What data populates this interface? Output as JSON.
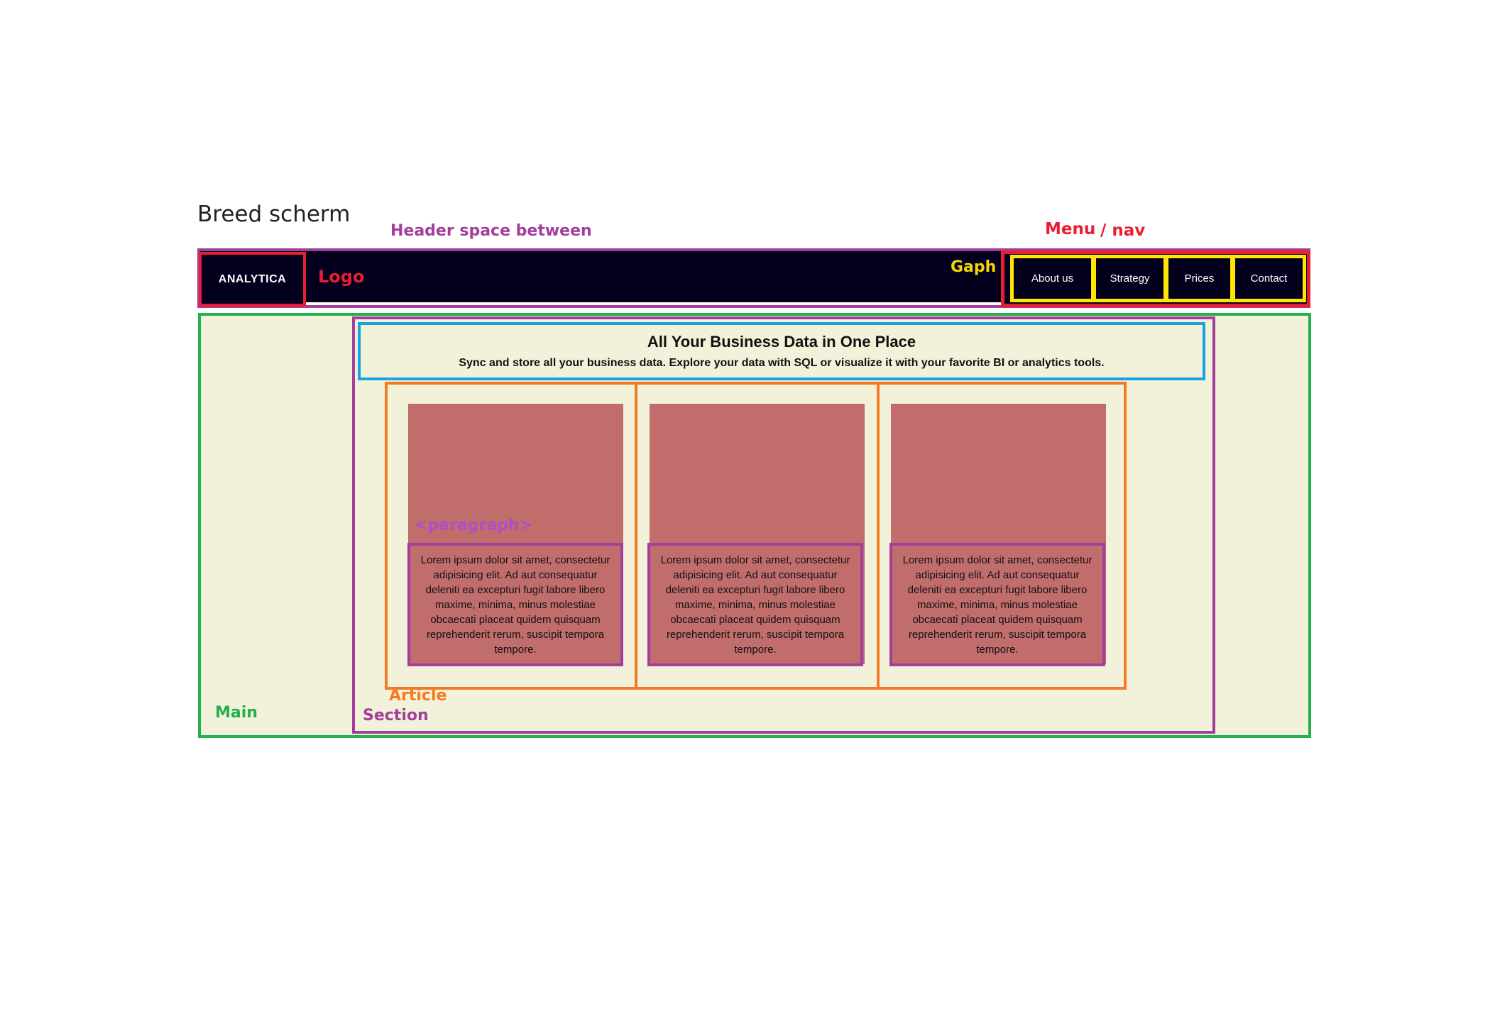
{
  "title": "Breed scherm",
  "annotations": {
    "header": "Header space between",
    "menu": "Menu",
    "nav": "/ nav",
    "logo": "Logo",
    "gaph": "Gaph",
    "paragraph": "<paragraph>",
    "article": "Article",
    "main": "Main",
    "section": "Section"
  },
  "logo": "ANALYTICA",
  "nav": [
    "About us",
    "Strategy",
    "Prices",
    "Contact"
  ],
  "heading": {
    "title": "All Your Business Data in One Place",
    "subtitle": "Sync and store all your business data. Explore your data with SQL or visualize it with your favorite BI or analytics tools."
  },
  "articles": [
    {
      "paragraph": "Lorem ipsum dolor sit amet, consectetur adipisicing elit. Ad aut consequatur deleniti ea excepturi fugit labore libero maxime, minima, minus molestiae obcaecati placeat quidem quisquam reprehenderit rerum, suscipit tempora tempore."
    },
    {
      "paragraph": "Lorem ipsum dolor sit amet, consectetur adipisicing elit. Ad aut consequatur deleniti ea excepturi fugit labore libero maxime, minima, minus molestiae obcaecati placeat quidem quisquam reprehenderit rerum, suscipit tempora tempore."
    },
    {
      "paragraph": "Lorem ipsum dolor sit amet, consectetur adipisicing elit. Ad aut consequatur deleniti ea excepturi fugit labore libero maxime, minima, minus molestiae obcaecati placeat quidem quisquam reprehenderit rerum, suscipit tempora tempore."
    }
  ],
  "colors": {
    "header_bg": "#03001e",
    "main_bg": "#f2f1d9",
    "card_bg": "#c06d6c",
    "main_outline": "#22b14c",
    "section_outline": "#a23f9c",
    "article_outline": "#f37b24",
    "heading_outline": "#15a3e6",
    "menu_outline": "#e81f30",
    "nav_item_outline": "#ffe600"
  }
}
